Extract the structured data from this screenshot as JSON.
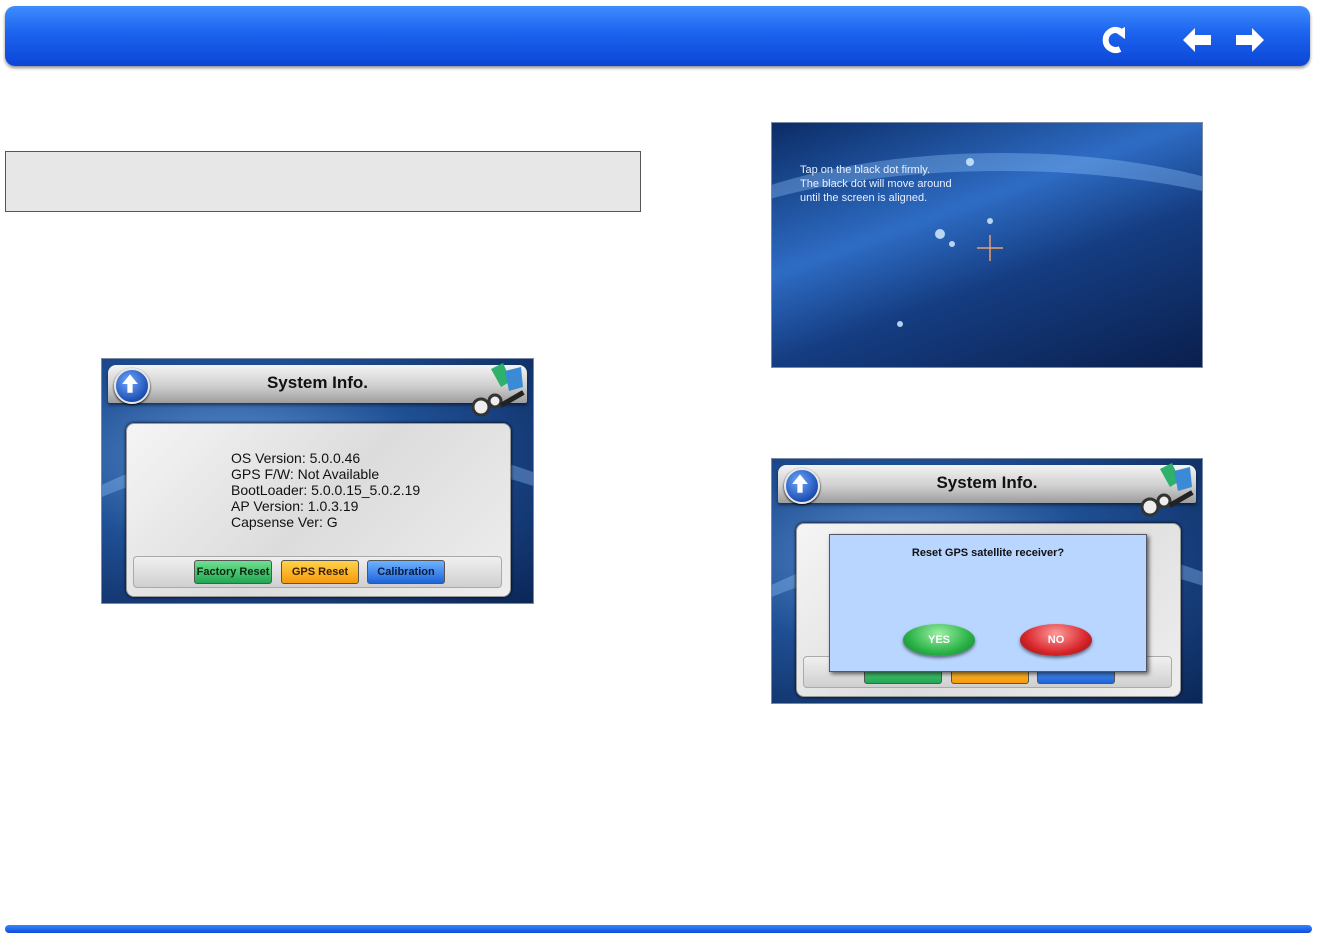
{
  "nav": {
    "back_icon": "back-arrow-icon",
    "prev_icon": "previous-page-icon",
    "next_icon": "next-page-icon",
    "accent": "#1c63ee"
  },
  "system_info": {
    "title": "System Info.",
    "lines": [
      "OS Version: 5.0.0.46",
      "GPS F/W: Not Available",
      "BootLoader: 5.0.0.15_5.0.2.19",
      "AP Version: 1.0.3.19",
      "Capsense Ver: G"
    ],
    "buttons": {
      "factory_reset": "Factory Reset",
      "gps_reset": "GPS Reset",
      "calibration": "Calibration"
    }
  },
  "calibration_screen": {
    "lines": [
      "Tap on the black dot firmly.",
      "The black dot will move around",
      "until the screen is aligned."
    ]
  },
  "gps_reset_dialog": {
    "title": "System Info.",
    "message": "Reset GPS satellite receiver?",
    "yes_label": "YES",
    "no_label": "NO"
  }
}
